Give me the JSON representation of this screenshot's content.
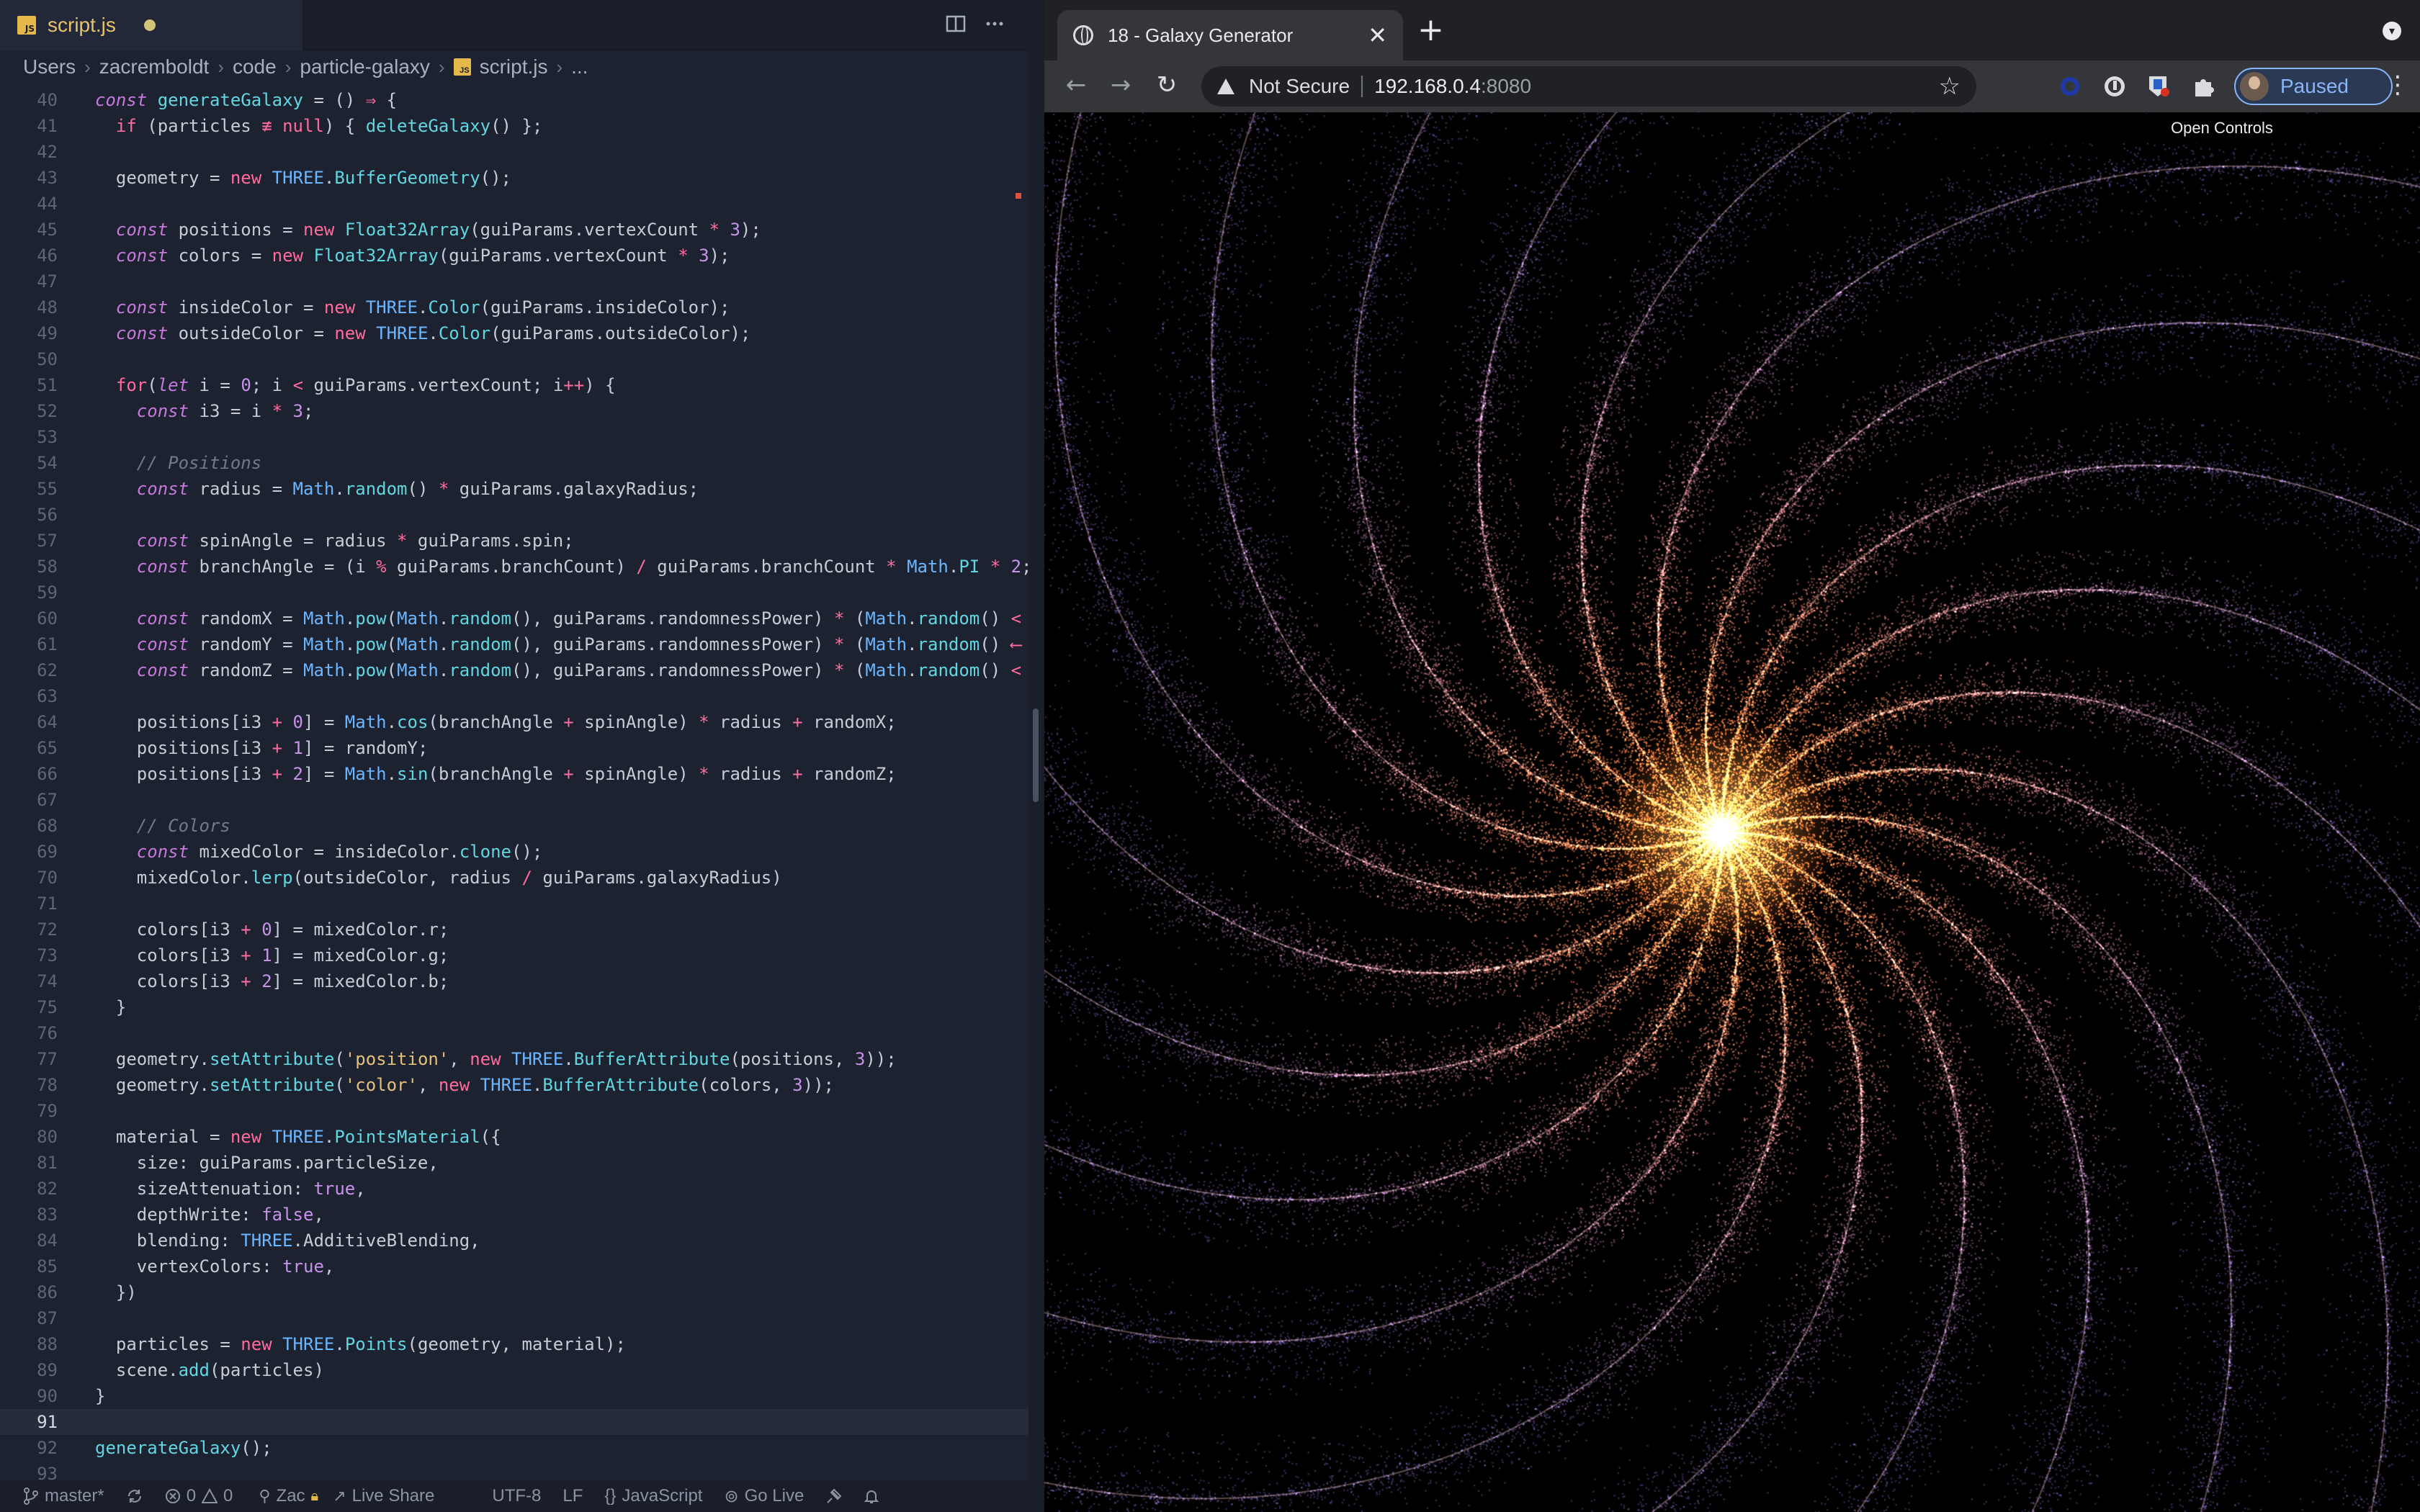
{
  "editor": {
    "tab_title": "script.js",
    "breadcrumb": [
      "Users",
      "zacremboldt",
      "code",
      "particle-galaxy",
      "script.js",
      "..."
    ],
    "lines": [
      {
        "n": "40",
        "html": "<span class='kw'>const</span> <span class='fn'>generateGalaxy</span> = () <span class='op'>⇒</span> {"
      },
      {
        "n": "41",
        "html": "  <span class='kw2'>if</span> (particles <span class='op'>≢</span> <span class='kw2'>null</span>) { <span class='fn'>deleteGalaxy</span>() };"
      },
      {
        "n": "42",
        "html": ""
      },
      {
        "n": "43",
        "html": "  geometry = <span class='kw2'>new</span> <span class='cls'>THREE</span>.<span class='fn'>BufferGeometry</span>();"
      },
      {
        "n": "44",
        "html": ""
      },
      {
        "n": "45",
        "html": "  <span class='kw'>const</span> positions = <span class='kw2'>new</span> <span class='fn'>Float32Array</span>(guiParams.vertexCount <span class='op'>*</span> <span class='num'>3</span>);"
      },
      {
        "n": "46",
        "html": "  <span class='kw'>const</span> colors = <span class='kw2'>new</span> <span class='fn'>Float32Array</span>(guiParams.vertexCount <span class='op'>*</span> <span class='num'>3</span>);"
      },
      {
        "n": "47",
        "html": ""
      },
      {
        "n": "48",
        "html": "  <span class='kw'>const</span> insideColor = <span class='kw2'>new</span> <span class='cls'>THREE</span>.<span class='fn'>Color</span>(guiParams.insideColor);"
      },
      {
        "n": "49",
        "html": "  <span class='kw'>const</span> outsideColor = <span class='kw2'>new</span> <span class='cls'>THREE</span>.<span class='fn'>Color</span>(guiParams.outsideColor);"
      },
      {
        "n": "50",
        "html": ""
      },
      {
        "n": "51",
        "html": "  <span class='kw2'>for</span>(<span class='kw'>let</span> i = <span class='num'>0</span>; i <span class='op'>&lt;</span> guiParams.vertexCount; i<span class='op'>++</span>) {"
      },
      {
        "n": "52",
        "html": "    <span class='kw'>const</span> i3 = i <span class='op'>*</span> <span class='num'>3</span>;"
      },
      {
        "n": "53",
        "html": ""
      },
      {
        "n": "54",
        "html": "    <span class='cm'>// Positions</span>"
      },
      {
        "n": "55",
        "html": "    <span class='kw'>const</span> radius = <span class='cls'>Math</span>.<span class='fn'>random</span>() <span class='op'>*</span> guiParams.galaxyRadius;"
      },
      {
        "n": "56",
        "html": ""
      },
      {
        "n": "57",
        "html": "    <span class='kw'>const</span> spinAngle = radius <span class='op'>*</span> guiParams.spin;"
      },
      {
        "n": "58",
        "html": "    <span class='kw'>const</span> branchAngle = (i <span class='op'>%</span> guiParams.branchCount) <span class='op'>/</span> guiParams.branchCount <span class='op'>*</span> <span class='cls'>Math</span>.<span class='fn'>PI</span> <span class='op'>*</span> <span class='num'>2</span>;"
      },
      {
        "n": "59",
        "html": ""
      },
      {
        "n": "60",
        "html": "    <span class='kw'>const</span> randomX = <span class='cls'>Math</span>.<span class='fn'>pow</span>(<span class='cls'>Math</span>.<span class='fn'>random</span>(), guiParams.randomnessPower) <span class='op'>*</span> (<span class='cls'>Math</span>.<span class='fn'>random</span>() <span class='op'>&lt;</span>"
      },
      {
        "n": "61",
        "html": "    <span class='kw'>const</span> randomY = <span class='cls'>Math</span>.<span class='fn'>pow</span>(<span class='cls'>Math</span>.<span class='fn'>random</span>(), guiParams.randomnessPower) <span class='op'>*</span> (<span class='cls'>Math</span>.<span class='fn'>random</span>() <span class='op'>⟵</span>"
      },
      {
        "n": "62",
        "html": "    <span class='kw'>const</span> randomZ = <span class='cls'>Math</span>.<span class='fn'>pow</span>(<span class='cls'>Math</span>.<span class='fn'>random</span>(), guiParams.randomnessPower) <span class='op'>*</span> (<span class='cls'>Math</span>.<span class='fn'>random</span>() <span class='op'>&lt;</span>"
      },
      {
        "n": "63",
        "html": ""
      },
      {
        "n": "64",
        "html": "    positions[i3 <span class='op'>+</span> <span class='num'>0</span>] = <span class='cls'>Math</span>.<span class='fn'>cos</span>(branchAngle <span class='op'>+</span> spinAngle) <span class='op'>*</span> radius <span class='op'>+</span> randomX;"
      },
      {
        "n": "65",
        "html": "    positions[i3 <span class='op'>+</span> <span class='num'>1</span>] = randomY;"
      },
      {
        "n": "66",
        "html": "    positions[i3 <span class='op'>+</span> <span class='num'>2</span>] = <span class='cls'>Math</span>.<span class='fn'>sin</span>(branchAngle <span class='op'>+</span> spinAngle) <span class='op'>*</span> radius <span class='op'>+</span> randomZ;"
      },
      {
        "n": "67",
        "html": ""
      },
      {
        "n": "68",
        "html": "    <span class='cm'>// Colors</span>"
      },
      {
        "n": "69",
        "html": "    <span class='kw'>const</span> mixedColor = insideColor.<span class='fn'>clone</span>();"
      },
      {
        "n": "70",
        "html": "    mixedColor.<span class='fn'>lerp</span>(outsideColor, radius <span class='op'>/</span> guiParams.galaxyRadius)"
      },
      {
        "n": "71",
        "html": ""
      },
      {
        "n": "72",
        "html": "    colors[i3 <span class='op'>+</span> <span class='num'>0</span>] = mixedColor.r;"
      },
      {
        "n": "73",
        "html": "    colors[i3 <span class='op'>+</span> <span class='num'>1</span>] = mixedColor.g;"
      },
      {
        "n": "74",
        "html": "    colors[i3 <span class='op'>+</span> <span class='num'>2</span>] = mixedColor.b;"
      },
      {
        "n": "75",
        "html": "  }"
      },
      {
        "n": "76",
        "html": ""
      },
      {
        "n": "77",
        "html": "  geometry.<span class='fn'>setAttribute</span>(<span class='str'>'position'</span>, <span class='kw2'>new</span> <span class='cls'>THREE</span>.<span class='fn'>BufferAttribute</span>(positions, <span class='num'>3</span>));"
      },
      {
        "n": "78",
        "html": "  geometry.<span class='fn'>setAttribute</span>(<span class='str'>'color'</span>, <span class='kw2'>new</span> <span class='cls'>THREE</span>.<span class='fn'>BufferAttribute</span>(colors, <span class='num'>3</span>));"
      },
      {
        "n": "79",
        "html": ""
      },
      {
        "n": "80",
        "html": "  material = <span class='kw2'>new</span> <span class='cls'>THREE</span>.<span class='fn'>PointsMaterial</span>({"
      },
      {
        "n": "81",
        "html": "    size: guiParams.particleSize,"
      },
      {
        "n": "82",
        "html": "    sizeAttenuation: <span class='bool'>true</span>,"
      },
      {
        "n": "83",
        "html": "    depthWrite: <span class='bool'>false</span>,"
      },
      {
        "n": "84",
        "html": "    blending: <span class='cls'>THREE</span>.AdditiveBlending,"
      },
      {
        "n": "85",
        "html": "    vertexColors: <span class='bool'>true</span>,"
      },
      {
        "n": "86",
        "html": "  })"
      },
      {
        "n": "87",
        "html": ""
      },
      {
        "n": "88",
        "html": "  particles = <span class='kw2'>new</span> <span class='cls'>THREE</span>.<span class='fn'>Points</span>(geometry, material);"
      },
      {
        "n": "89",
        "html": "  scene.<span class='fn'>add</span>(particles)"
      },
      {
        "n": "90",
        "html": "}"
      },
      {
        "n": "91",
        "html": "",
        "current": true
      },
      {
        "n": "92",
        "html": "<span class='fn'>generateGalaxy</span>();"
      },
      {
        "n": "93",
        "html": ""
      }
    ],
    "status": {
      "branch": "master*",
      "errors": "0",
      "warnings": "0",
      "user": "Zac",
      "live_share": "Live Share",
      "encoding": "UTF-8",
      "eol": "LF",
      "language": "JavaScript",
      "go_live": "Go Live"
    }
  },
  "browser": {
    "tab_title": "18 - Galaxy Generator",
    "security": "Not Secure",
    "url_host": "192.168.0.4",
    "url_port": ":8080",
    "profile_status": "Paused",
    "gui_label": "Open Controls",
    "galaxy_colors": {
      "inside": "#ff7a1a",
      "outside": "#a07cf0",
      "core": "#fff6dc"
    }
  }
}
